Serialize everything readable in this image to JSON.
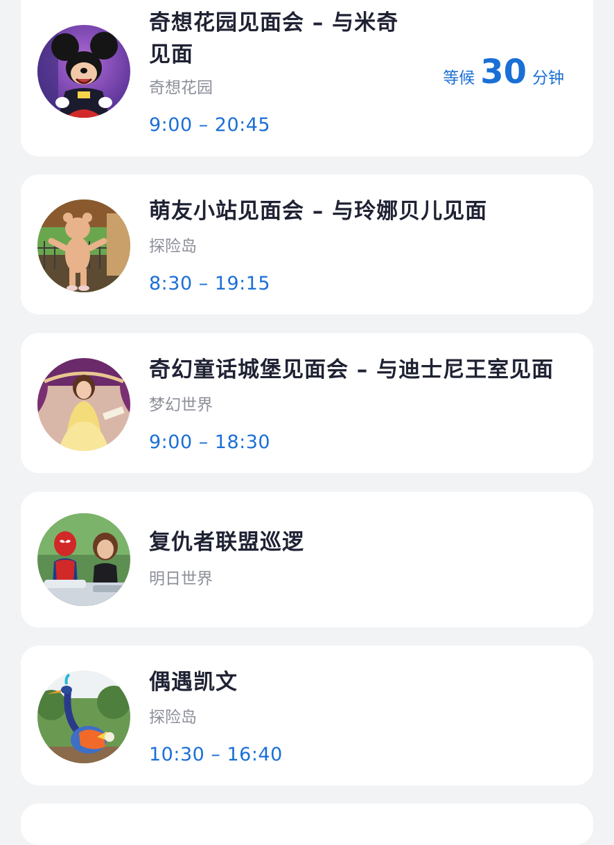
{
  "cards": [
    {
      "title_line1": "奇想花园见面会 – 与米奇",
      "title_line2": "见面",
      "location": "奇想花园",
      "hours": "9:00 – 20:45",
      "wait": {
        "prefix": "等候",
        "minutes": "30",
        "unit": "分钟"
      },
      "avatar": "mickey-mouse-photo"
    },
    {
      "title": "萌友小站见面会 – 与玲娜贝儿见面",
      "location": "探险岛",
      "hours": "8:30 – 19:15",
      "avatar": "linabell-photo"
    },
    {
      "title": "奇幻童话城堡见面会 – 与迪士尼王室见面",
      "location": "梦幻世界",
      "hours": "9:00 – 18:30",
      "avatar": "belle-princess-photo"
    },
    {
      "title": "复仇者联盟巡逻",
      "location": "明日世界",
      "avatar": "spiderman-black-widow-photo"
    },
    {
      "title": "偶遇凯文",
      "location": "探险岛",
      "hours": "10:30 – 16:40",
      "avatar": "kevin-bird-photo"
    }
  ]
}
